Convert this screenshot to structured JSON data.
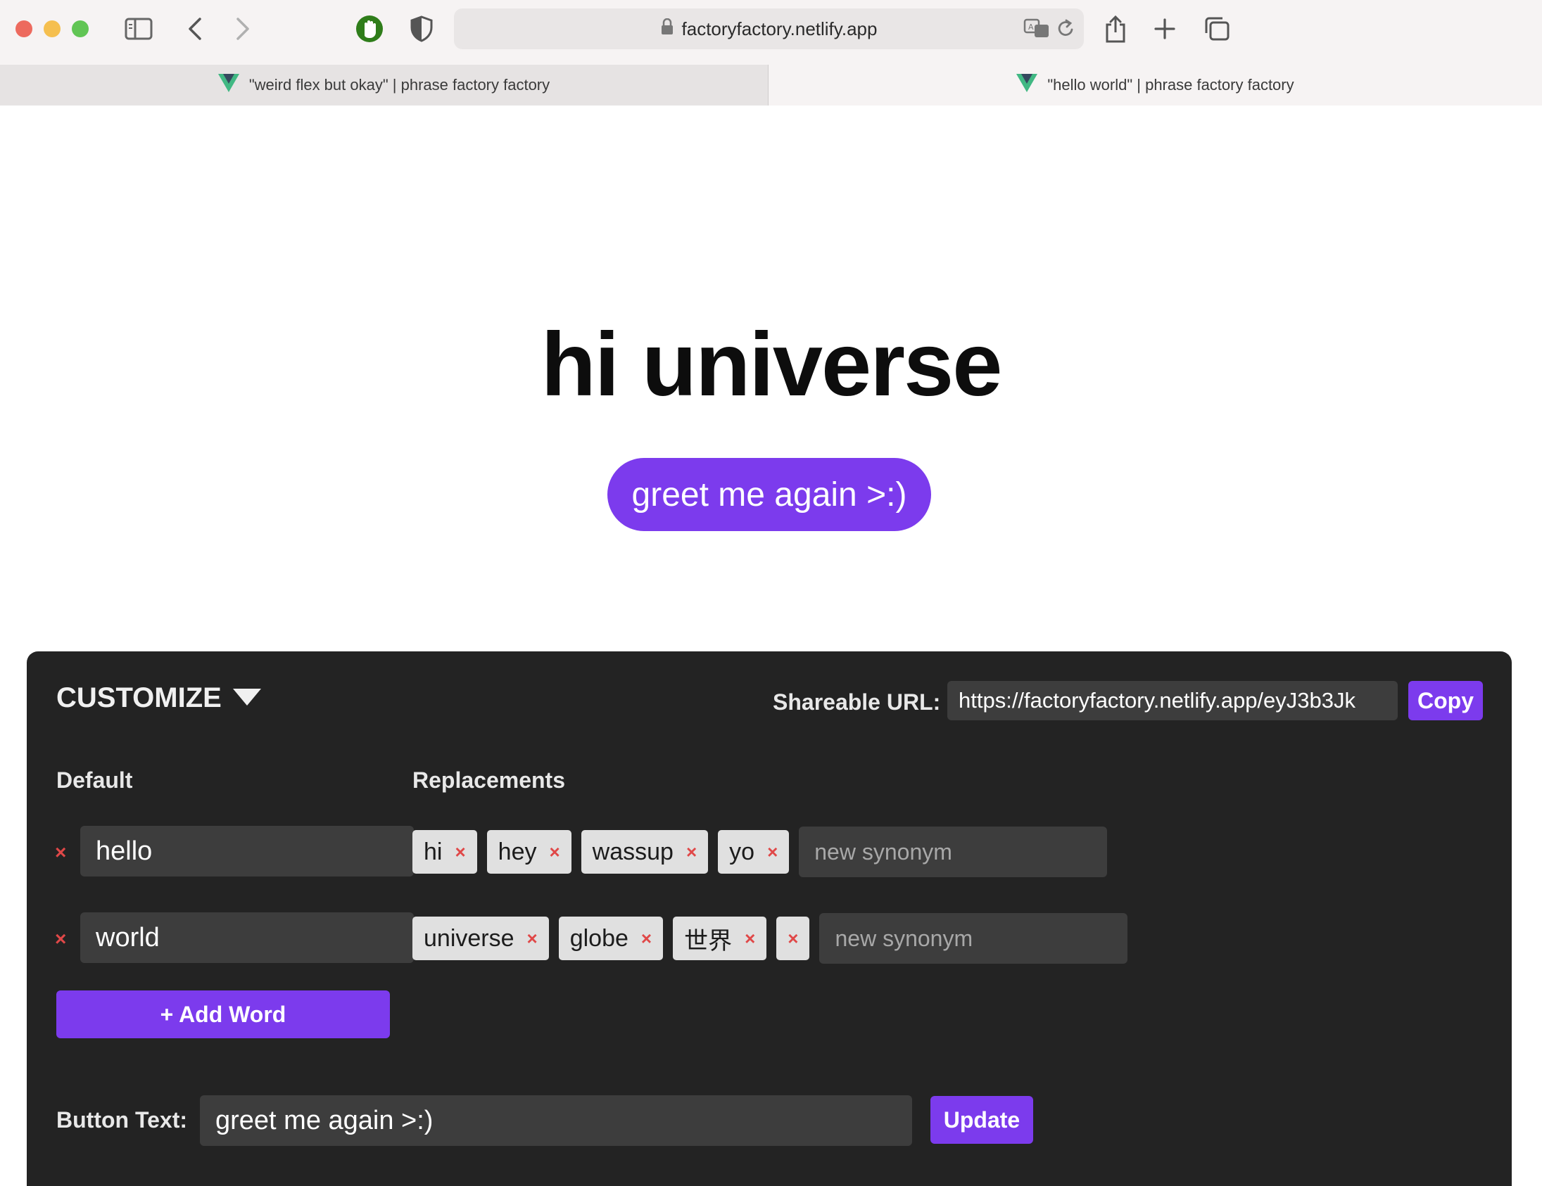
{
  "browser": {
    "url": "factoryfactory.netlify.app",
    "tabs": [
      {
        "title": "\"weird flex but okay\" | phrase factory factory"
      },
      {
        "title": "\"hello world\" | phrase factory factory"
      }
    ]
  },
  "main": {
    "headline": "hi universe",
    "greet_button": "greet me again >:)"
  },
  "customize": {
    "title": "CUSTOMIZE",
    "share_label": "Shareable URL:",
    "share_url": "https://factoryfactory.netlify.app/eyJ3b3Jk",
    "copy_label": "Copy",
    "default_header": "Default",
    "replacements_header": "Replacements",
    "remove_glyph": "×",
    "rows": [
      {
        "word": "hello",
        "synonyms": [
          "hi",
          "hey",
          "wassup",
          "yo"
        ],
        "placeholder": "new synonym"
      },
      {
        "word": "world",
        "synonyms": [
          "universe",
          "globe",
          "世界",
          ""
        ],
        "placeholder": "new synonym"
      }
    ],
    "add_word_label": "+ Add Word",
    "button_text_label": "Button Text:",
    "button_text_value": "greet me again >:)",
    "update_label": "Update"
  },
  "colors": {
    "accent": "#7c3bed",
    "panel": "#232323",
    "remove": "#e04848"
  }
}
